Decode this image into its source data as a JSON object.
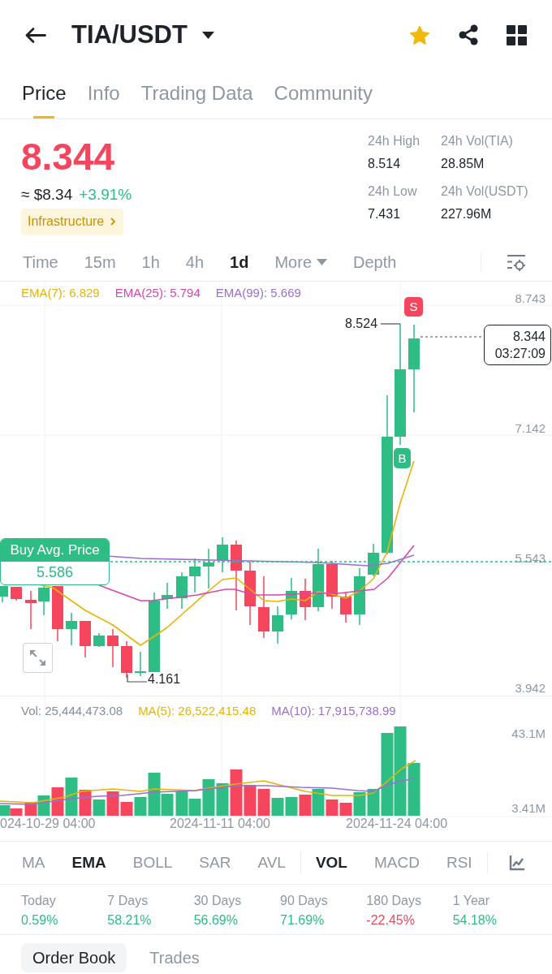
{
  "header": {
    "title": "TIA/USDT",
    "favorite": true
  },
  "tabs": [
    {
      "label": "Price",
      "selected": true
    },
    {
      "label": "Info",
      "selected": false
    },
    {
      "label": "Trading Data",
      "selected": false
    },
    {
      "label": "Community",
      "selected": false
    }
  ],
  "price": {
    "last": "8.344",
    "last_falling": true,
    "fiat": "≈ $8.34",
    "change": "+3.91%",
    "change_negative": false,
    "tag": "Infrastructure"
  },
  "stats": [
    {
      "label": "24h High",
      "value": "8.514"
    },
    {
      "label": "24h Vol(TIA)",
      "value": "28.85M"
    },
    {
      "label": "24h Low",
      "value": "7.431"
    },
    {
      "label": "24h Vol(USDT)",
      "value": "227.96M"
    }
  ],
  "intervals": [
    {
      "label": "Time",
      "kind": "option",
      "selected": false
    },
    {
      "label": "15m",
      "kind": "option",
      "selected": false
    },
    {
      "label": "1h",
      "kind": "option",
      "selected": false
    },
    {
      "label": "4h",
      "kind": "option",
      "selected": false
    },
    {
      "label": "1d",
      "kind": "option",
      "selected": true
    },
    {
      "label": "More",
      "kind": "dropdown",
      "selected": false
    },
    {
      "label": "Depth",
      "kind": "option",
      "selected": false
    }
  ],
  "chart": {
    "legend": [
      {
        "label": "EMA(7): 6.829",
        "color": "#eab308"
      },
      {
        "label": "EMA(25): 5.794",
        "color": "#d946b0"
      },
      {
        "label": "EMA(99): 5.669",
        "color": "#9b6fd0"
      }
    ],
    "y_labels": [
      "8.743",
      "7.142",
      "5.543",
      "3.942"
    ],
    "high_label": "8.524",
    "low_label": "4.161",
    "sell_marker": "S",
    "buy_marker": "B",
    "last_price": "8.344",
    "countdown": "03:27:09",
    "buy_average": {
      "title": "Buy Avg. Price",
      "value": "5.586"
    }
  },
  "volume": {
    "legend": [
      {
        "label": "Vol: 25,444,473.08",
        "color": "#848e9c"
      },
      {
        "label": "MA(5): 26,522,415.48",
        "color": "#eab308"
      },
      {
        "label": "MA(10): 17,915,738.99",
        "color": "#9b6fd0"
      }
    ],
    "y_labels": [
      "43.1M",
      "3.41M"
    ],
    "x_labels": [
      "024-10-29 04:00",
      "2024-11-11 04:00",
      "2024-11-24 04:00"
    ]
  },
  "main_indicators": [
    {
      "label": "MA",
      "selected": false
    },
    {
      "label": "EMA",
      "selected": true
    },
    {
      "label": "BOLL",
      "selected": false
    },
    {
      "label": "SAR",
      "selected": false
    },
    {
      "label": "AVL",
      "selected": false
    }
  ],
  "sub_indicators": [
    {
      "label": "VOL",
      "selected": true
    },
    {
      "label": "MACD",
      "selected": false
    },
    {
      "label": "RSI",
      "selected": false
    }
  ],
  "performance": [
    {
      "period": "Today",
      "change": "0.59%",
      "negative": false
    },
    {
      "period": "7 Days",
      "change": "58.21%",
      "negative": false
    },
    {
      "period": "30 Days",
      "change": "56.69%",
      "negative": false
    },
    {
      "period": "90 Days",
      "change": "71.69%",
      "negative": false
    },
    {
      "period": "180 Days",
      "change": "-22.45%",
      "negative": true
    },
    {
      "period": "1 Year",
      "change": "54.18%",
      "negative": false
    }
  ],
  "book_tabs": [
    {
      "label": "Order Book",
      "selected": true
    },
    {
      "label": "Trades",
      "selected": false
    }
  ]
}
